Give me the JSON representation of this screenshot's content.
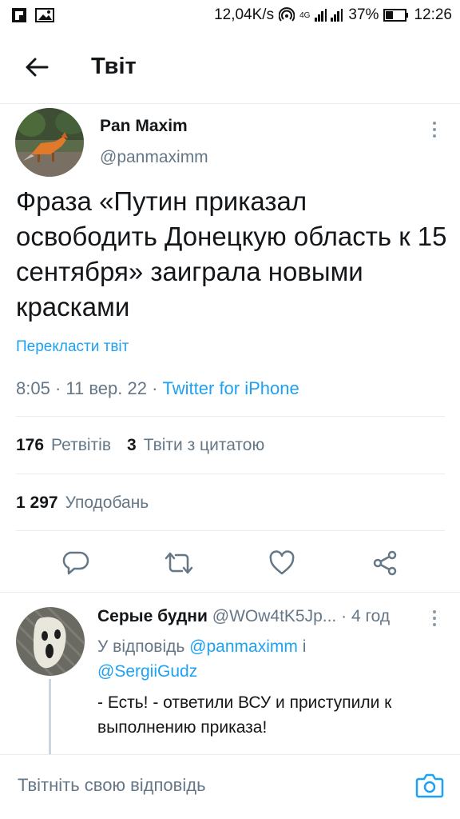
{
  "status_bar": {
    "speed": "12,04K/s",
    "network": "4G",
    "battery": "37%",
    "time": "12:26",
    "icons": [
      "flipboard-icon",
      "gallery-icon",
      "hotspot-icon",
      "signal-icon",
      "battery-icon"
    ]
  },
  "header": {
    "title": "Твіт",
    "back_icon": "arrow-left-icon"
  },
  "tweet": {
    "author_name": "Pan Maxim",
    "author_handle": "@panmaximm",
    "text": "Фраза «Путин приказал освободить Донецкую область к 15 сентября» заиграла новыми красками",
    "translate_label": "Перекласти твіт",
    "time": "8:05",
    "date": "11 вер. 22",
    "source": "Twitter for iPhone",
    "retweets_count": "176",
    "retweets_label": "Ретвітів",
    "quotes_count": "3",
    "quotes_label": "Твіти з цитатою",
    "likes_count": "1 297",
    "likes_label": "Уподобань",
    "actions": [
      "reply-icon",
      "retweet-icon",
      "like-icon",
      "share-icon"
    ]
  },
  "reply": {
    "author_name": "Серые будни",
    "author_handle": "@WOw4tK5Jp...",
    "age": "4 год",
    "reply_to_prefix": "У відповідь",
    "mention_1": "@panmaximm",
    "conjunction": "і",
    "mention_2": "@SergiiGudz",
    "text": "- Есть! - ответили ВСУ и приступили к выполнению приказа!"
  },
  "compose": {
    "placeholder": "Твітніть свою відповідь",
    "camera_icon": "camera-icon"
  },
  "colors": {
    "accent": "#1da1f2",
    "secondary_text": "#657786",
    "divider": "#e6ecf0"
  }
}
